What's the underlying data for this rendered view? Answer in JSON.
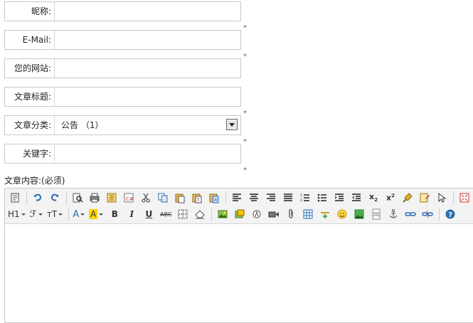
{
  "form": {
    "nickname": {
      "label": "昵称:",
      "value": "",
      "placeholder": ""
    },
    "email": {
      "label": "E-Mail:",
      "value": "",
      "placeholder": ""
    },
    "website": {
      "label": "您的网站:",
      "value": "",
      "placeholder": ""
    },
    "article_title": {
      "label": "文章标题:",
      "value": "",
      "placeholder": ""
    },
    "article_category": {
      "label": "文章分类:",
      "selected": "公告 （1）"
    },
    "keywords": {
      "label": "关键字:",
      "value": "",
      "placeholder": ""
    },
    "required_mark": "*"
  },
  "editor": {
    "content_label": "文章内容:(必须)",
    "heading_label": "H1",
    "superscript_sub_label": "x",
    "subscript_num": "2",
    "superscript_num": "2",
    "bold_label": "B",
    "italic_label": "I",
    "underline_label": "U",
    "strikethrough_label": "ABC",
    "font_color_label": "A",
    "highlight_label": "A",
    "font_size_label": "тT",
    "font_family_label": "ℱ"
  },
  "colors": {
    "border": "#c9c9c9",
    "toolbar_bg": "#f3f3f3",
    "accent_blue": "#2b6cb0",
    "highlight_yellow": "#ffd800"
  }
}
